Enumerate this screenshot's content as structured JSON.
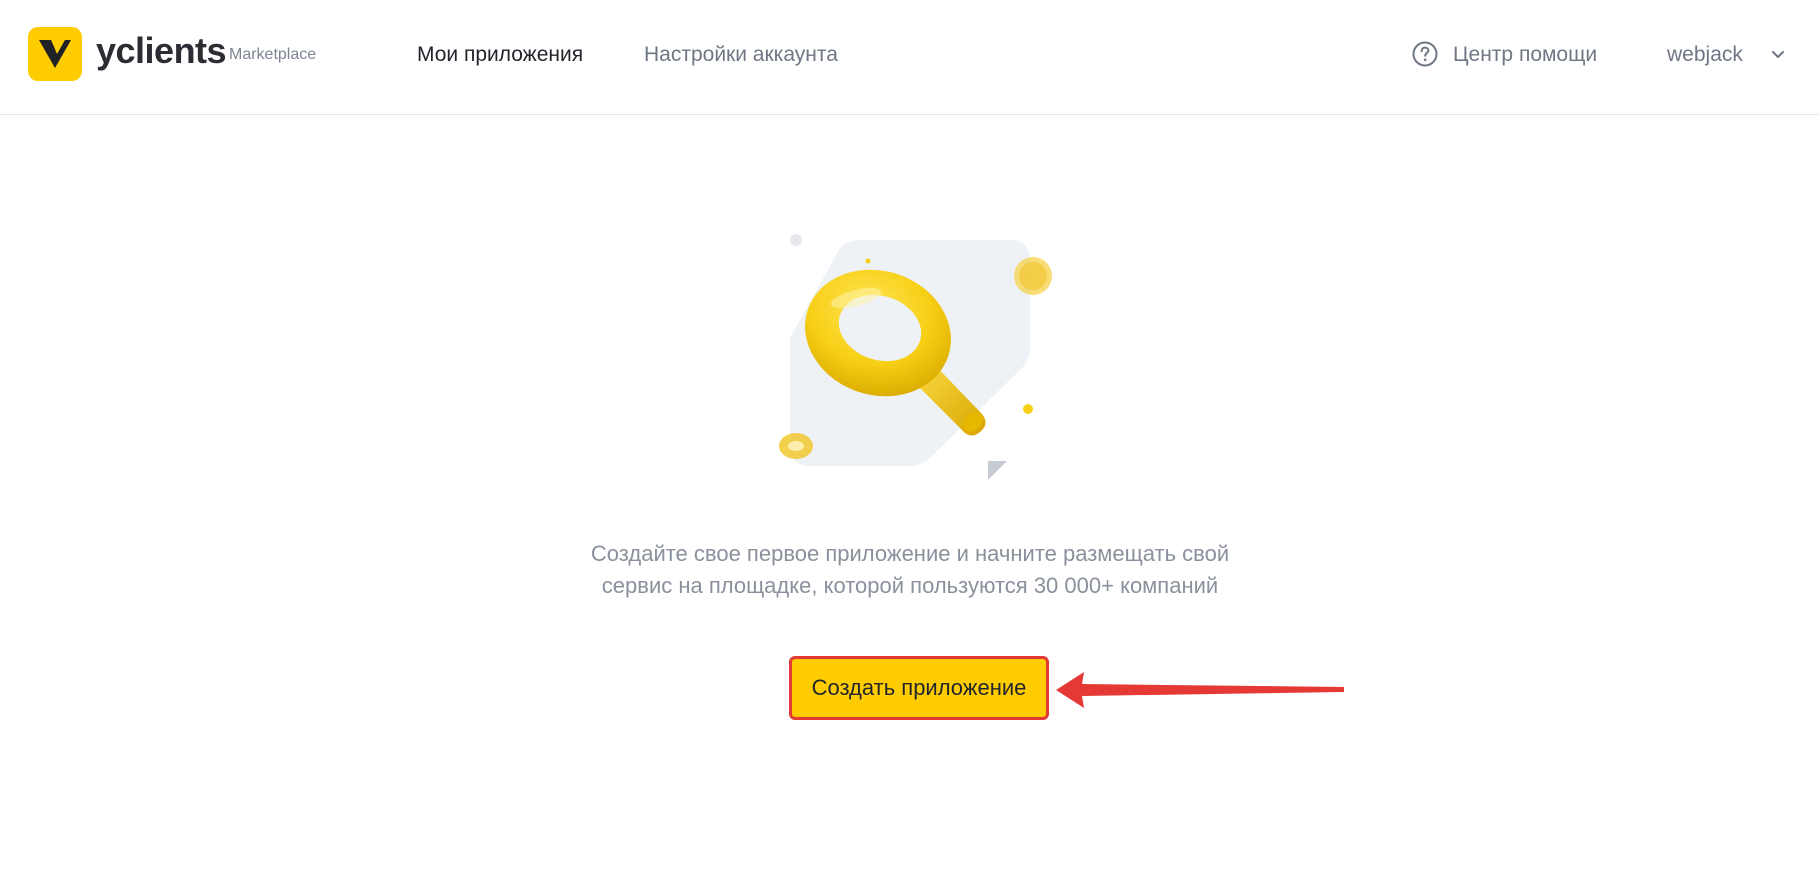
{
  "header": {
    "brand": "yclients",
    "brand_sub": "Marketplace",
    "nav": {
      "my_apps": "Мои приложения",
      "account_settings": "Настройки аккаунта"
    },
    "help_label": "Центр помощи",
    "user_name": "webjack"
  },
  "main": {
    "empty_line1": "Создайте свое первое приложение и начните размещать свой",
    "empty_line2": "сервис на площадке, которой пользуются 30 000+ компаний",
    "create_button": "Создать приложение"
  },
  "colors": {
    "brand_yellow": "#ffcc00",
    "highlight_red": "#e53935"
  },
  "icons": [
    "logo-icon",
    "help-icon",
    "chevron-down-icon",
    "magnifier-illustration",
    "arrow-annotation"
  ]
}
